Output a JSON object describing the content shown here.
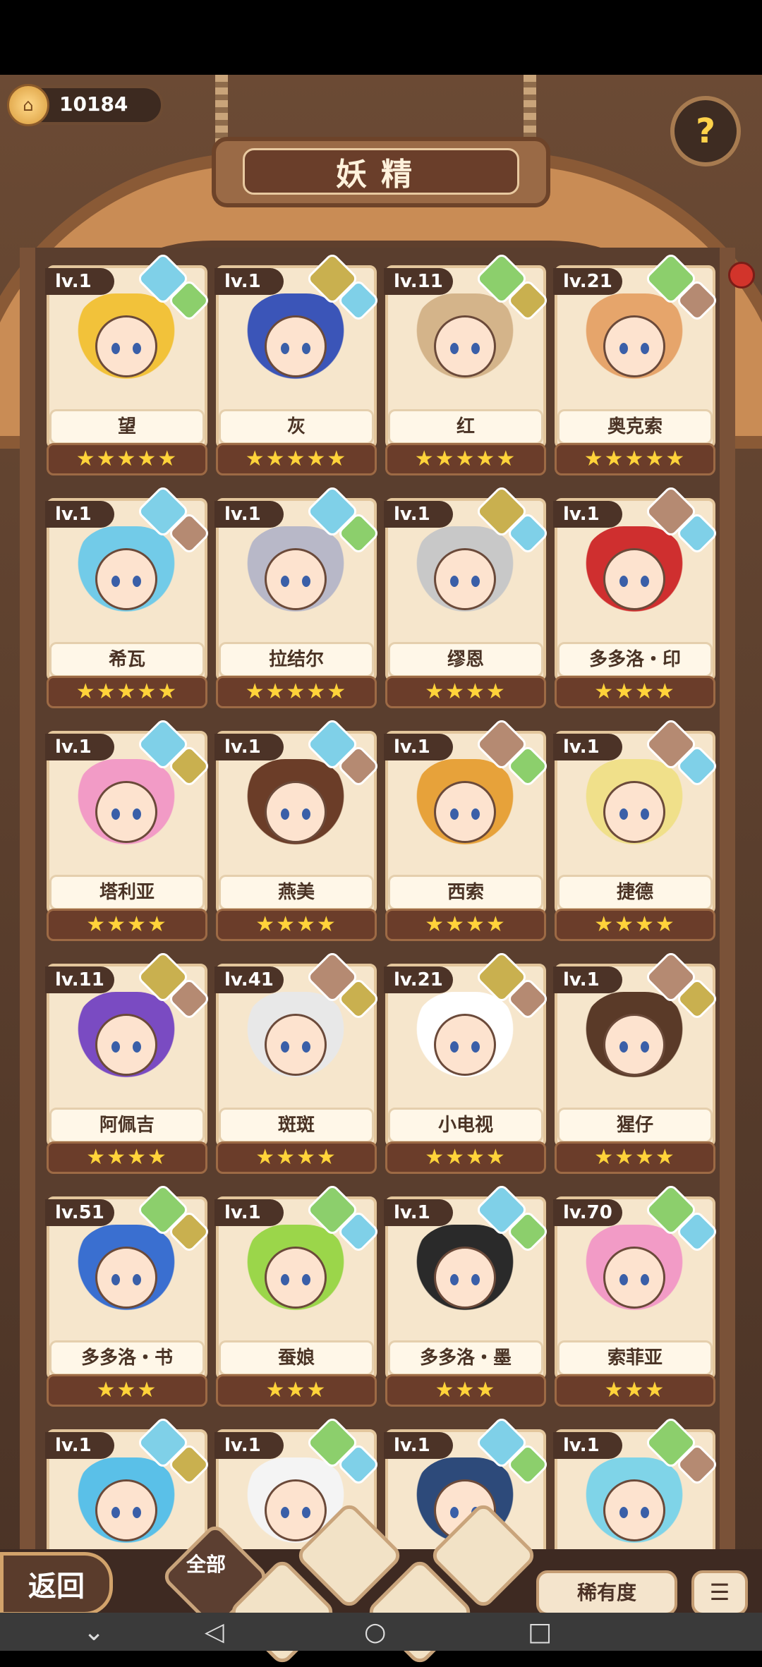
{
  "header": {
    "coins": "10184",
    "title": "妖精",
    "help_icon": "question-sprout-icon"
  },
  "cards": [
    {
      "lv": "lv.1",
      "name": "望",
      "stars": "★★★★★",
      "hair": "#f2c23a",
      "gems": [
        "water",
        "leaf"
      ]
    },
    {
      "lv": "lv.1",
      "name": "灰",
      "stars": "★★★★★",
      "hair": "#3b55b8",
      "gems": [
        "earth",
        "water"
      ]
    },
    {
      "lv": "lv.11",
      "name": "红",
      "stars": "★★★★★",
      "hair": "#d4b48a",
      "gems": [
        "leaf",
        "earth"
      ]
    },
    {
      "lv": "lv.21",
      "name": "奥克索",
      "stars": "★★★★★",
      "hair": "#e6a56b",
      "gems": [
        "leaf",
        "rock"
      ]
    },
    {
      "lv": "lv.1",
      "name": "希瓦",
      "stars": "★★★★★",
      "hair": "#72cbe8",
      "gems": [
        "water",
        "rock"
      ]
    },
    {
      "lv": "lv.1",
      "name": "拉结尔",
      "stars": "★★★★★",
      "hair": "#b8b8c8",
      "gems": [
        "water",
        "leaf"
      ]
    },
    {
      "lv": "lv.1",
      "name": "缪恩",
      "stars": "★★★★",
      "hair": "#c8c8c8",
      "gems": [
        "earth",
        "water"
      ]
    },
    {
      "lv": "lv.1",
      "name": "多多洛・印",
      "stars": "★★★★",
      "hair": "#cf2f2f",
      "gems": [
        "rock",
        "water"
      ]
    },
    {
      "lv": "lv.1",
      "name": "塔利亚",
      "stars": "★★★★",
      "hair": "#f29bc6",
      "gems": [
        "water",
        "earth"
      ]
    },
    {
      "lv": "lv.1",
      "name": "燕美",
      "stars": "★★★★",
      "hair": "#6b3d28",
      "gems": [
        "water",
        "rock"
      ]
    },
    {
      "lv": "lv.1",
      "name": "西索",
      "stars": "★★★★",
      "hair": "#e7a23a",
      "gems": [
        "rock",
        "leaf"
      ]
    },
    {
      "lv": "lv.1",
      "name": "捷德",
      "stars": "★★★★",
      "hair": "#f0e08a",
      "gems": [
        "rock",
        "water"
      ]
    },
    {
      "lv": "lv.11",
      "name": "阿佩吉",
      "stars": "★★★★",
      "hair": "#7a4bc2",
      "gems": [
        "earth",
        "rock"
      ]
    },
    {
      "lv": "lv.41",
      "name": "斑斑",
      "stars": "★★★★",
      "hair": "#e8e8e8",
      "gems": [
        "rock",
        "earth"
      ]
    },
    {
      "lv": "lv.21",
      "name": "小电视",
      "stars": "★★★★",
      "hair": "#ffffff",
      "gems": [
        "earth",
        "rock"
      ]
    },
    {
      "lv": "lv.1",
      "name": "猩仔",
      "stars": "★★★★",
      "hair": "#5a3a28",
      "gems": [
        "rock",
        "earth"
      ]
    },
    {
      "lv": "lv.51",
      "name": "多多洛・书",
      "stars": "★★★",
      "hair": "#3a6fd0",
      "gems": [
        "leaf",
        "earth"
      ]
    },
    {
      "lv": "lv.1",
      "name": "蚕娘",
      "stars": "★★★",
      "hair": "#9bd64a",
      "gems": [
        "leaf",
        "water"
      ]
    },
    {
      "lv": "lv.1",
      "name": "多多洛・墨",
      "stars": "★★★",
      "hair": "#2a2a2a",
      "gems": [
        "water",
        "leaf"
      ]
    },
    {
      "lv": "lv.70",
      "name": "索菲亚",
      "stars": "★★★",
      "hair": "#f29bc6",
      "gems": [
        "leaf",
        "water"
      ]
    },
    {
      "lv": "lv.1",
      "name": "",
      "stars": "",
      "hair": "#5ac0e8",
      "gems": [
        "water",
        "earth"
      ]
    },
    {
      "lv": "lv.1",
      "name": "",
      "stars": "",
      "hair": "#f4f4f4",
      "gems": [
        "leaf",
        "water"
      ]
    },
    {
      "lv": "lv.1",
      "name": "",
      "stars": "",
      "hair": "#2d4a7a",
      "gems": [
        "water",
        "leaf"
      ]
    },
    {
      "lv": "lv.1",
      "name": "",
      "stars": "",
      "hair": "#7fd4e8",
      "gems": [
        "leaf",
        "rock"
      ]
    }
  ],
  "bottom": {
    "back_label": "返回",
    "all_label": "全部",
    "rarity_label": "稀有度",
    "menu_icon": "list-icon"
  },
  "nav": {
    "back": "back-triangle-icon",
    "home": "home-circle-icon",
    "recent": "recent-square-icon",
    "down": "chevron-down-icon"
  }
}
